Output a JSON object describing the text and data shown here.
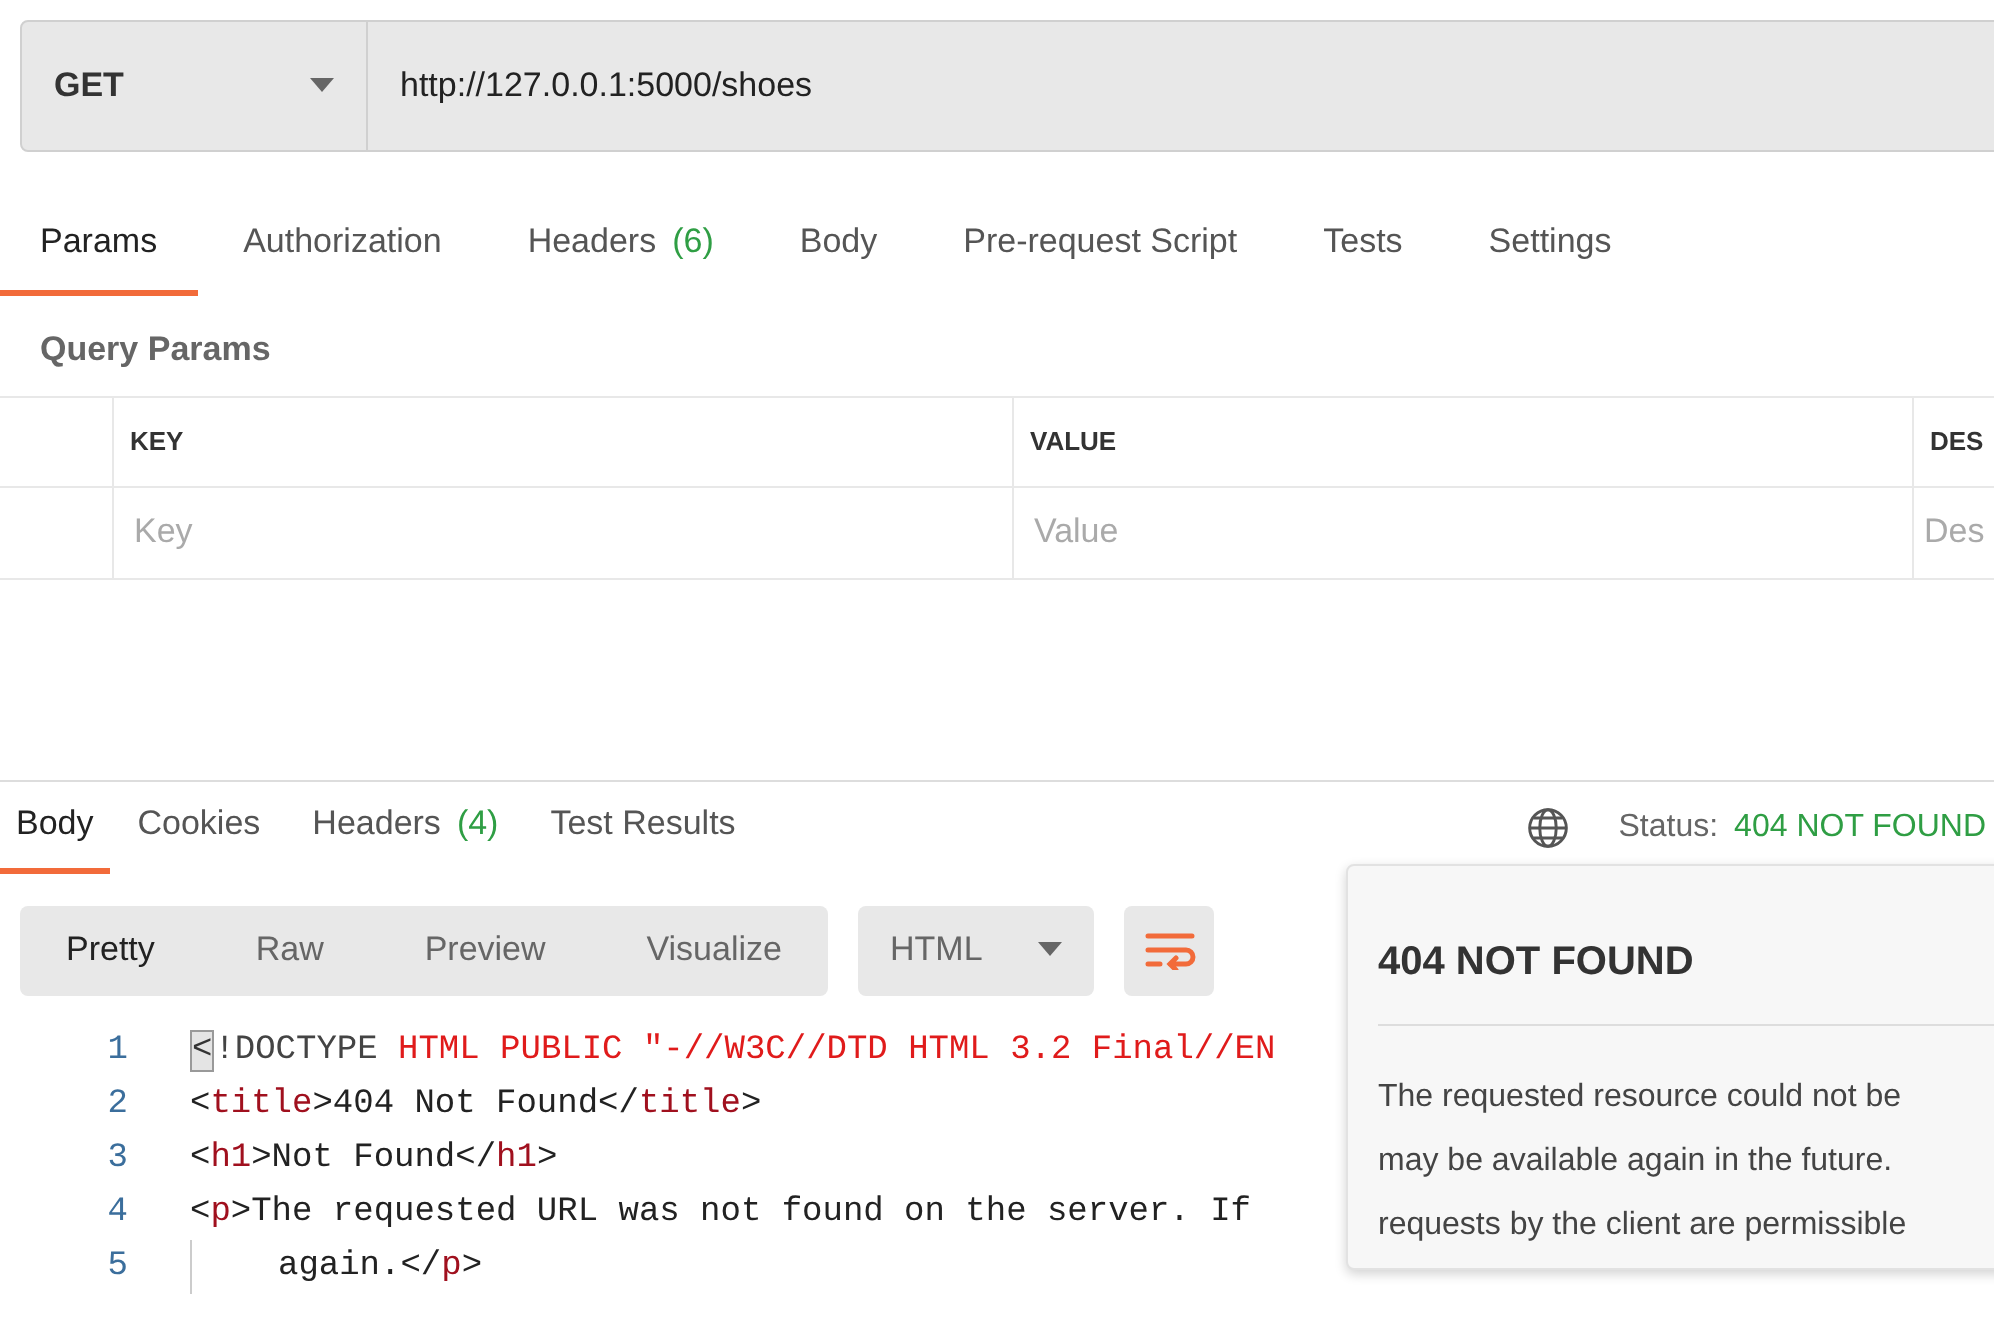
{
  "request": {
    "method": "GET",
    "url": "http://127.0.0.1:5000/shoes"
  },
  "request_tabs": [
    {
      "label": "Params",
      "selected": true
    },
    {
      "label": "Authorization",
      "selected": false
    },
    {
      "label": "Headers",
      "count": "(6)",
      "selected": false
    },
    {
      "label": "Body",
      "selected": false
    },
    {
      "label": "Pre-request Script",
      "selected": false
    },
    {
      "label": "Tests",
      "selected": false
    },
    {
      "label": "Settings",
      "selected": false
    }
  ],
  "query_params": {
    "title": "Query Params",
    "columns": [
      "KEY",
      "VALUE",
      "DES"
    ],
    "placeholders": [
      "Key",
      "Value",
      "Des"
    ]
  },
  "response_tabs": [
    {
      "label": "Body",
      "selected": true
    },
    {
      "label": "Cookies",
      "selected": false
    },
    {
      "label": "Headers",
      "count": "(4)",
      "selected": false
    },
    {
      "label": "Test Results",
      "selected": false
    }
  ],
  "status": {
    "label": "Status:",
    "value": "404 NOT FOUND"
  },
  "view_modes": [
    {
      "label": "Pretty",
      "selected": true
    },
    {
      "label": "Raw",
      "selected": false
    },
    {
      "label": "Preview",
      "selected": false
    },
    {
      "label": "Visualize",
      "selected": false
    }
  ],
  "format": "HTML",
  "code_lines": [
    {
      "number": "1",
      "kind": "line",
      "tokens": [
        {
          "kind": "cursor",
          "text": "<"
        },
        {
          "kind": "keyword",
          "text": "!DOCTYPE"
        },
        {
          "kind": "string",
          "text": " HTML PUBLIC \"-//W3C//DTD HTML 3.2 Final//EN"
        }
      ]
    },
    {
      "number": "2",
      "kind": "line",
      "tokens": [
        {
          "kind": "punct",
          "text": "<"
        },
        {
          "kind": "tag",
          "text": "title"
        },
        {
          "kind": "punct",
          "text": ">404 Not Found</"
        },
        {
          "kind": "tag",
          "text": "title"
        },
        {
          "kind": "punct",
          "text": ">"
        }
      ]
    },
    {
      "number": "3",
      "kind": "line",
      "tokens": [
        {
          "kind": "punct",
          "text": "<"
        },
        {
          "kind": "tag",
          "text": "h1"
        },
        {
          "kind": "punct",
          "text": ">Not Found</"
        },
        {
          "kind": "tag",
          "text": "h1"
        },
        {
          "kind": "punct",
          "text": ">"
        }
      ]
    },
    {
      "number": "4",
      "kind": "line",
      "tokens": [
        {
          "kind": "punct",
          "text": "<"
        },
        {
          "kind": "tag",
          "text": "p"
        },
        {
          "kind": "punct",
          "text": ">The requested URL was not found on the server. If"
        }
      ]
    },
    {
      "number": "5",
      "kind": "continuation",
      "tokens": [
        {
          "kind": "punct",
          "text": "again.</"
        },
        {
          "kind": "tag",
          "text": "p"
        },
        {
          "kind": "punct",
          "text": ">"
        }
      ]
    }
  ],
  "popover": {
    "title": "404 NOT FOUND",
    "lines": [
      "The requested resource could not be",
      "may be available again in the future.",
      "requests by the client are permissible"
    ]
  }
}
